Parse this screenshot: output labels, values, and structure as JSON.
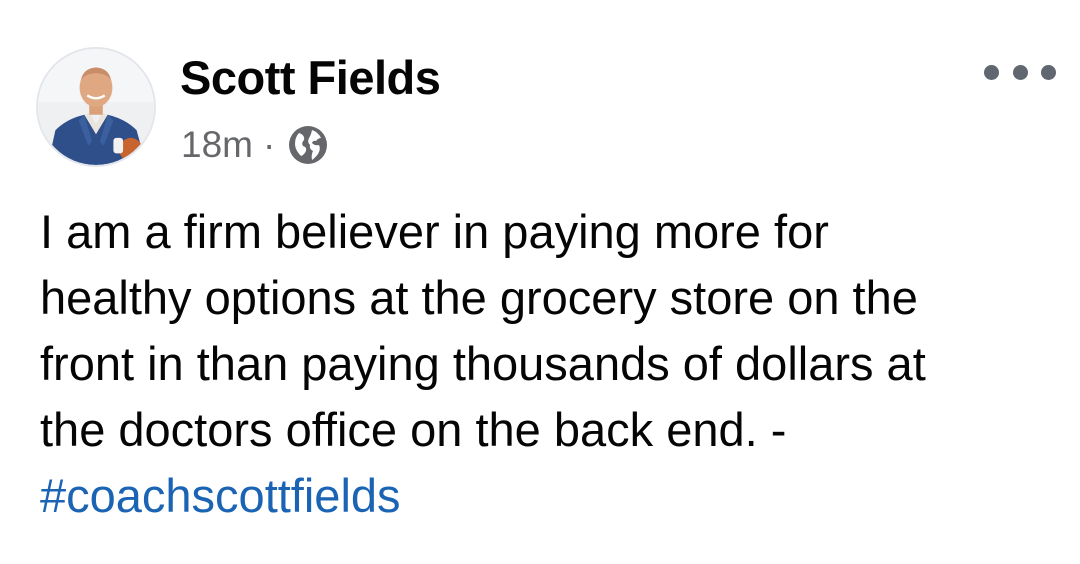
{
  "post": {
    "author": {
      "name": "Scott Fields",
      "avatar_icon": "profile-photo"
    },
    "meta": {
      "timestamp": "18m",
      "separator": "·",
      "audience_icon": "globe-icon"
    },
    "more_icon": "more-options-icon",
    "text_lines": [
      "I am a firm believer in paying more for",
      "healthy options at the grocery store on the",
      "front in than paying thousands of dollars at",
      "the doctors office on the back end. -"
    ],
    "hashtag": "#coachscottfields"
  },
  "colors": {
    "text": "#050505",
    "secondary_text": "#65676b",
    "hashtag": "#1b64b4",
    "icon": "#606770"
  }
}
